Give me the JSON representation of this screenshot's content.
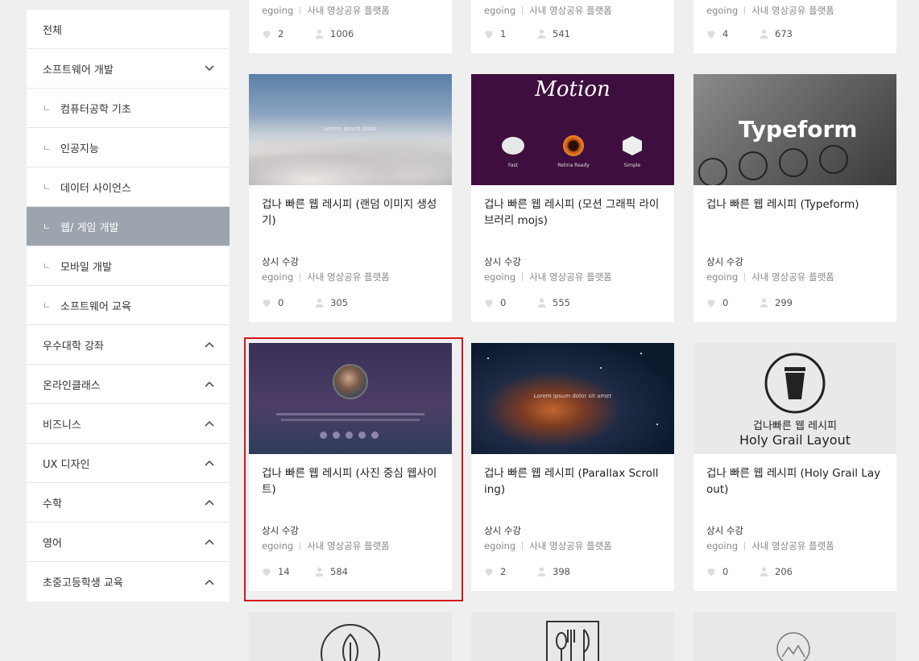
{
  "sidebar": {
    "items": [
      {
        "label": "전체",
        "type": "top"
      },
      {
        "label": "소프트웨어 개발",
        "type": "expandable",
        "chevron": "down"
      },
      {
        "label": "컴퓨터공학 기초",
        "type": "sub"
      },
      {
        "label": "인공지능",
        "type": "sub"
      },
      {
        "label": "데이터 사이언스",
        "type": "sub"
      },
      {
        "label": "웹/ 게임 개발",
        "type": "sub",
        "active": true
      },
      {
        "label": "모바일 개발",
        "type": "sub"
      },
      {
        "label": "소프트웨어 교육",
        "type": "sub"
      },
      {
        "label": "우수대학 강좌",
        "type": "expandable",
        "chevron": "up"
      },
      {
        "label": "온라인클래스",
        "type": "expandable",
        "chevron": "up"
      },
      {
        "label": "비즈니스",
        "type": "expandable",
        "chevron": "up"
      },
      {
        "label": "UX 디자인",
        "type": "expandable",
        "chevron": "up"
      },
      {
        "label": "수학",
        "type": "expandable",
        "chevron": "up"
      },
      {
        "label": "영어",
        "type": "expandable",
        "chevron": "up"
      },
      {
        "label": "초중고등학생 교육",
        "type": "expandable",
        "chevron": "up"
      }
    ],
    "sub_marker": "ㄴ"
  },
  "top_row": [
    {
      "author": "egoing",
      "org": "사내 영상공유 플랫폼",
      "likes": "2",
      "views": "1006"
    },
    {
      "author": "egoing",
      "org": "사내 영상공유 플랫폼",
      "likes": "1",
      "views": "541"
    },
    {
      "author": "egoing",
      "org": "사내 영상공유 플랫폼",
      "likes": "4",
      "views": "673"
    }
  ],
  "cards": [
    {
      "title": "겁나 빠른 웹 레시피 (랜덤 이미지 생성기)",
      "category": "상시 수강",
      "author": "egoing",
      "org": "사내 영상공유 플랫폼",
      "likes": "0",
      "views": "305",
      "thumb_text": "Lorem ipsum dolor"
    },
    {
      "title": "겁나 빠른 웹 레시피 (모션 그래픽 라이브러리 mojs)",
      "category": "상시 수강",
      "author": "egoing",
      "org": "사내 영상공유 플랫폼",
      "likes": "0",
      "views": "555",
      "thumb_text": "Motion",
      "thumb_features": [
        "Fast",
        "Retina Ready",
        "Simple"
      ]
    },
    {
      "title": "겁나 빠른 웹 레시피 (Typeform)",
      "category": "상시 수강",
      "author": "egoing",
      "org": "사내 영상공유 플랫폼",
      "likes": "0",
      "views": "299",
      "thumb_text": "Typeform"
    },
    {
      "title": "겁나 빠른 웹 레시피 (사진 중심 웹사이트)",
      "category": "상시 수강",
      "author": "egoing",
      "org": "사내 영상공유 플랫폼",
      "likes": "14",
      "views": "584"
    },
    {
      "title": "겁나 빠른 웹 레시피 (Parallax Scrolling)",
      "category": "상시 수강",
      "author": "egoing",
      "org": "사내 영상공유 플랫폼",
      "likes": "2",
      "views": "398",
      "thumb_text": "Lorem ipsum dolor sit amet"
    },
    {
      "title": "겁나 빠른 웹 레시피 (Holy Grail Layout)",
      "category": "상시 수강",
      "author": "egoing",
      "org": "사내 영상공유 플랫폼",
      "likes": "0",
      "views": "206",
      "thumb_line1": "겁나빠른 웹 레시피",
      "thumb_line2": "Holy Grail Layout"
    }
  ],
  "colors": {
    "active_bg": "#9ca4ad",
    "highlight": "#d9141b",
    "page_bg": "#efefef"
  }
}
